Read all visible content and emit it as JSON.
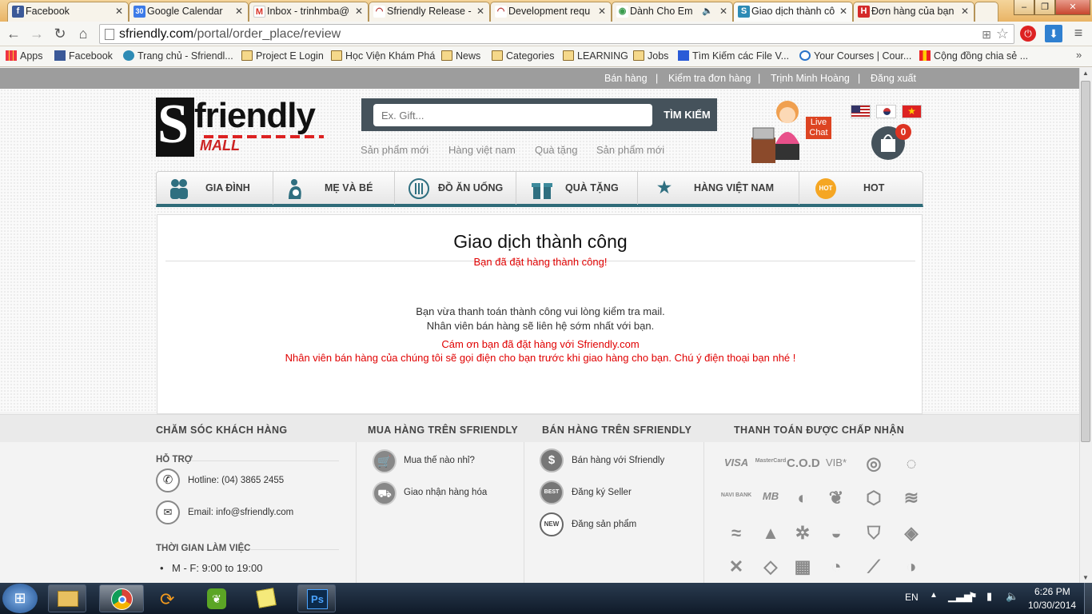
{
  "browser": {
    "tabs": [
      {
        "label": "Facebook",
        "icon": "facebook-icon",
        "color": "#3b5998",
        "glyph": "f"
      },
      {
        "label": "Google Calendar",
        "icon": "calendar-icon",
        "color": "#3d7be8",
        "glyph": "30"
      },
      {
        "label": "Inbox - trinhmba@",
        "icon": "gmail-icon",
        "color": "#d93025",
        "glyph": "M"
      },
      {
        "label": "Sfriendly Release -",
        "icon": "redmine-icon",
        "color": "#b32d2d",
        "glyph": "◠"
      },
      {
        "label": "Development requ",
        "icon": "redmine-icon",
        "color": "#b32d2d",
        "glyph": "◠"
      },
      {
        "label": "Dành Cho Em",
        "icon": "chrome-icon",
        "color": "#3a9c4e",
        "glyph": "◉"
      },
      {
        "label": "Giao dịch thành cô",
        "icon": "sfriendly-icon",
        "color": "#2e8bb5",
        "glyph": "S"
      },
      {
        "label": "Đơn hàng của bạn",
        "icon": "hotel-icon",
        "color": "#d42a2a",
        "glyph": "H"
      }
    ],
    "window_controls": [
      "–",
      "❐",
      "✕"
    ],
    "url_host": "sfriendly.com",
    "url_path": "/portal/order_place/review",
    "bookmarks": [
      {
        "label": "Apps",
        "icon": "apps-icon"
      },
      {
        "label": "Facebook",
        "icon": "facebook-icon"
      },
      {
        "label": "Trang chủ - Sfriendl...",
        "icon": "sfriendly-icon"
      },
      {
        "label": "Project E Login",
        "icon": "folder-icon"
      },
      {
        "label": "Học Viện Khám Phá",
        "icon": "folder-icon"
      },
      {
        "label": "News",
        "icon": "folder-icon"
      },
      {
        "label": "Categories",
        "icon": "folder-icon"
      },
      {
        "label": "LEARNING",
        "icon": "folder-icon"
      },
      {
        "label": "Jobs",
        "icon": "folder-icon"
      },
      {
        "label": "Tìm Kiếm các File V...",
        "icon": "search-icon"
      },
      {
        "label": "Your Courses | Cour...",
        "icon": "coursera-icon"
      },
      {
        "label": "Cộng đồng chia sẻ ...",
        "icon": "chart-icon"
      }
    ]
  },
  "site": {
    "top_links": [
      "Bán hàng",
      "Kiểm tra đơn hàng",
      "Trịnh Minh Hoàng",
      "Đăng xuất"
    ],
    "logo_main": "friendly",
    "logo_s": "S",
    "logo_sub": "MALL",
    "search": {
      "placeholder": "Ex. Gift...",
      "button": "TÌM KIẾM"
    },
    "sub_links": [
      "Sản phẩm mới",
      "Hàng việt nam",
      "Quà tặng",
      "Sản phẩm mới"
    ],
    "live_chat": "Live Chat",
    "cart_count": "0",
    "nav": [
      {
        "label": "GIA ĐÌNH",
        "icon": "family-icon"
      },
      {
        "label": "MẸ VÀ BÉ",
        "icon": "mother-baby-icon"
      },
      {
        "label": "ĐỒ ĂN UỐNG",
        "icon": "food-icon"
      },
      {
        "label": "QUÀ TẶNG",
        "icon": "gift-icon"
      },
      {
        "label": "HÀNG VIỆT NAM",
        "icon": "star-icon"
      },
      {
        "label": "HOT",
        "icon": "hot-icon",
        "badge": "HOT"
      }
    ]
  },
  "content": {
    "title": "Giao dịch thành công",
    "subtitle": "Bạn đã đặt hàng thành công!",
    "line1": "Bạn vừa thanh toán thành công vui lòng kiểm tra mail.",
    "line2": "Nhân viên bán hàng sẽ liên hệ sớm nhất với bạn.",
    "thanks": "Cám ơn bạn đã đặt hàng với Sfriendly.com",
    "notice": "Nhân viên bán hàng của chúng tôi sẽ gọi điện cho bạn trước khi giao hàng cho bạn. Chú ý điện thoại bạn nhé !"
  },
  "footer": {
    "col1": {
      "heading": "CHĂM SÓC KHÁCH HÀNG",
      "support_label": "HỖ TRỢ",
      "hotline": "Hotline: (04) 3865 2455",
      "email": "Email: info@sfriendly.com",
      "hours_label": "THỜI GIAN LÀM VIỆC",
      "hours": "M - F: 9:00 to 19:00"
    },
    "col2": {
      "heading": "MUA HÀNG TRÊN SFRIENDLY",
      "items": [
        "Mua thế nào nhỉ?",
        "Giao nhận hàng hóa"
      ]
    },
    "col3": {
      "heading": "BÁN HÀNG TRÊN SFRIENDLY",
      "items": [
        "Bán hàng với Sfriendly",
        "Đăng ký Seller",
        "Đăng sản phẩm"
      ],
      "icon_glyphs": [
        "$",
        "BEST",
        "NEW"
      ]
    },
    "col4": {
      "heading": "THANH TOÁN ĐƯỢC CHẤP NHẬN",
      "payments": [
        "VISA",
        "MasterCard",
        "C.O.D",
        "VIB*",
        "◎",
        "◌",
        "NAVI BANK",
        "MB",
        "◐",
        "❦",
        "⬡",
        "≋",
        "≈",
        "▲",
        "✲",
        "◒",
        "⛉",
        "◈",
        "✕",
        "◇",
        "▦",
        "◔",
        "⟋",
        "◑"
      ]
    }
  },
  "taskbar": {
    "apps": [
      "explorer",
      "chrome",
      "network",
      "evernote",
      "stickynotes",
      "photoshop"
    ],
    "lang": "EN",
    "time": "6:26 PM",
    "date": "10/30/2014"
  },
  "colors": {
    "accent": "#45525b",
    "red": "#e00000",
    "nav_border": "#2e6b78"
  }
}
